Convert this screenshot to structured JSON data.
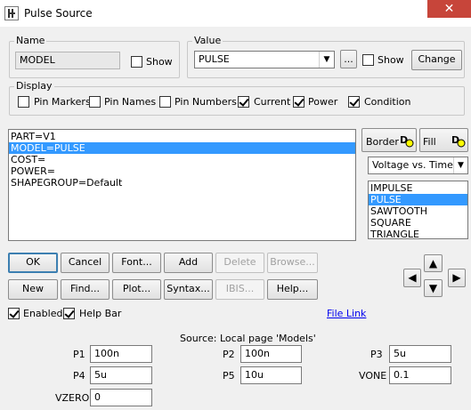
{
  "window": {
    "title": "Pulse Source",
    "close_glyph": "✕"
  },
  "name_group": {
    "legend": "Name",
    "value": "MODEL",
    "show_label": "Show",
    "show_checked": false
  },
  "value_group": {
    "legend": "Value",
    "value": "PULSE",
    "ellipsis_label": "...",
    "show_label": "Show",
    "show_checked": false,
    "change_label": "Change"
  },
  "display_group": {
    "legend": "Display",
    "options": [
      {
        "label": "Pin Markers",
        "checked": false
      },
      {
        "label": "Pin Names",
        "checked": false
      },
      {
        "label": "Pin Numbers",
        "checked": false
      },
      {
        "label": "Current",
        "checked": true
      },
      {
        "label": "Power",
        "checked": true
      },
      {
        "label": "Condition",
        "checked": true
      }
    ]
  },
  "attributes": {
    "items": [
      "PART=V1",
      "MODEL=PULSE",
      "COST=",
      "POWER=",
      "SHAPEGROUP=Default"
    ],
    "selected_index": 1
  },
  "style_buttons": {
    "border_label": "Border",
    "fill_label": "Fill"
  },
  "plot_type": {
    "selected": "Voltage vs. Time"
  },
  "shapes": {
    "items": [
      "IMPULSE",
      "PULSE",
      "SAWTOOTH",
      "SQUARE",
      "TRIANGLE"
    ],
    "selected_index": 1
  },
  "buttons_row1": [
    {
      "label": "OK",
      "enabled": true
    },
    {
      "label": "Cancel",
      "enabled": true
    },
    {
      "label": "Font...",
      "enabled": true
    },
    {
      "label": "Add",
      "enabled": true
    },
    {
      "label": "Delete",
      "enabled": false
    },
    {
      "label": "Browse...",
      "enabled": false
    }
  ],
  "buttons_row2": [
    {
      "label": "New",
      "enabled": true
    },
    {
      "label": "Find...",
      "enabled": true
    },
    {
      "label": "Plot...",
      "enabled": true
    },
    {
      "label": "Syntax...",
      "enabled": true
    },
    {
      "label": "IBIS...",
      "enabled": false
    },
    {
      "label": "Help...",
      "enabled": true
    }
  ],
  "options": {
    "enabled_label": "Enabled",
    "enabled_checked": true,
    "helpbar_label": "Help Bar",
    "helpbar_checked": true,
    "file_link": "File Link"
  },
  "source_text": "Source: Local page 'Models'",
  "params": [
    {
      "name": "P1",
      "value": "100n"
    },
    {
      "name": "P2",
      "value": "100n"
    },
    {
      "name": "P3",
      "value": "5u"
    },
    {
      "name": "P4",
      "value": "5u"
    },
    {
      "name": "P5",
      "value": "10u"
    },
    {
      "name": "VONE",
      "value": "0.1"
    },
    {
      "name": "VZERO",
      "value": "0"
    }
  ]
}
